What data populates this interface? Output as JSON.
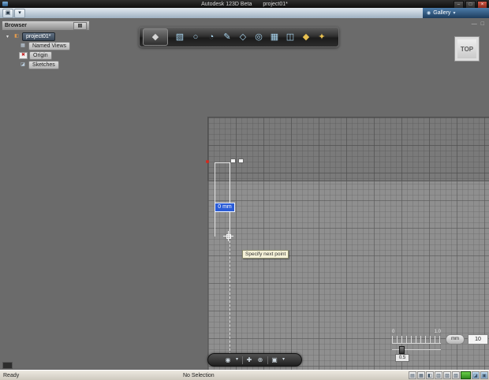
{
  "title_bar": {
    "app_title": "Autodesk 123D Beta",
    "doc_title": "project01*",
    "minimize_glyph": "–",
    "maximize_glyph": "□",
    "close_glyph": "×"
  },
  "menu_bar": {
    "app_glyph": "▣",
    "dropdown_glyph": "▾",
    "gallery_icon_glyph": "◉",
    "gallery_label": "Gallery",
    "gallery_arrow_glyph": "▾"
  },
  "doc_controls": {
    "minimize_glyph": "—",
    "restore_glyph": "□"
  },
  "browser_panel": {
    "title": "Browser",
    "menu_glyph": "▤",
    "items": [
      {
        "label": "project01*",
        "arrow": "▾",
        "icon_glyph": "◧"
      },
      {
        "label": "Named Views",
        "icon_glyph": "▦"
      },
      {
        "label": "Origin",
        "icon_glyph": "✖"
      },
      {
        "label": "Sketches",
        "icon_glyph": "◪"
      }
    ]
  },
  "toolbar": {
    "menu_glyph": "◆",
    "icons": [
      {
        "name": "primitive-box-icon",
        "glyph": "▧"
      },
      {
        "name": "primitive-sphere-icon",
        "glyph": "○"
      },
      {
        "name": "primitive-cylinder-icon",
        "glyph": "◔"
      },
      {
        "name": "sketch-icon",
        "glyph": "✎"
      },
      {
        "name": "extrude-icon",
        "glyph": "◇"
      },
      {
        "name": "revolve-icon",
        "glyph": "◎"
      },
      {
        "name": "pattern-icon",
        "glyph": "▦"
      },
      {
        "name": "combine-icon",
        "glyph": "◫"
      },
      {
        "name": "material-icon",
        "glyph": "◆"
      },
      {
        "name": "snap-icon",
        "glyph": "✦"
      }
    ]
  },
  "viewcube": {
    "label": "TOP"
  },
  "sketch": {
    "dimension_value": "0 mm",
    "tooltip": "Specify next point"
  },
  "navbar": {
    "icons": [
      {
        "name": "orbit-icon",
        "glyph": "◉"
      },
      {
        "name": "orbit-menu-arrow-icon",
        "glyph": "▾"
      },
      {
        "name": "pan-icon",
        "glyph": "✚"
      },
      {
        "name": "zoom-icon",
        "glyph": "⊕"
      },
      {
        "name": "display-settings-icon",
        "glyph": "▣"
      },
      {
        "name": "display-menu-arrow-icon",
        "glyph": "▾"
      }
    ]
  },
  "ruler": {
    "tick_min": "0",
    "tick_max": "1.0",
    "unit_label": "mm",
    "grid_value": "10",
    "snap_value": "0.5"
  },
  "status_bar": {
    "ready": "Ready",
    "selection": "No Selection",
    "icons": [
      {
        "name": "grid-toggle-icon",
        "glyph": "▤"
      },
      {
        "name": "snap-toggle-icon",
        "glyph": "▦"
      },
      {
        "name": "ortho-toggle-icon",
        "glyph": "◧"
      },
      {
        "name": "layers-icon",
        "glyph": "▥"
      },
      {
        "name": "shading-icon",
        "glyph": "▨"
      },
      {
        "name": "units-icon",
        "glyph": "▧"
      }
    ],
    "extra_icons": [
      {
        "name": "help-panel-icon",
        "glyph": "◪"
      },
      {
        "name": "notify-panel-icon",
        "glyph": "▣"
      }
    ]
  },
  "colors": {
    "accent_blue": "#2a5cd6",
    "canvas_gray": "#6b6b6b",
    "sketch_plane_gray": "#8f8f8f",
    "status_green": "#3fa82e",
    "tooltip_yellow": "#f6f2d8"
  }
}
